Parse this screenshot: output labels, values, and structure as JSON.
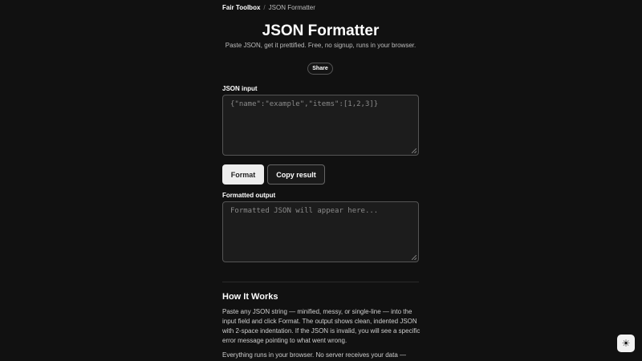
{
  "breadcrumb": {
    "home": "Fair Toolbox",
    "separator": "/",
    "current": "JSON Formatter"
  },
  "page": {
    "title": "JSON Formatter",
    "subtitle": "Paste JSON, get it prettified. Free, no signup, runs in your browser."
  },
  "share": {
    "label": "Share"
  },
  "input": {
    "label": "JSON input",
    "placeholder": "{\"name\":\"example\",\"items\":[1,2,3]}"
  },
  "actions": {
    "format_label": "Format",
    "copy_label": "Copy result"
  },
  "output": {
    "label": "Formatted output",
    "placeholder": "Formatted JSON will appear here..."
  },
  "how_it_works": {
    "title": "How It Works",
    "paragraph1": "Paste any JSON string — minified, messy, or single-line — into the input field and click Format. The output shows clean, indented JSON with 2-space indentation. If the JSON is invalid, you will see a specific error message pointing to what went wrong.",
    "paragraph2": "Everything runs in your browser. No server receives your data —"
  },
  "theme_toggle": {
    "icon": "sun-icon",
    "glyph": "☀"
  },
  "colors": {
    "background": "#111111",
    "textarea_bg": "#1c1c1c",
    "primary_button": "#eeeeee"
  }
}
